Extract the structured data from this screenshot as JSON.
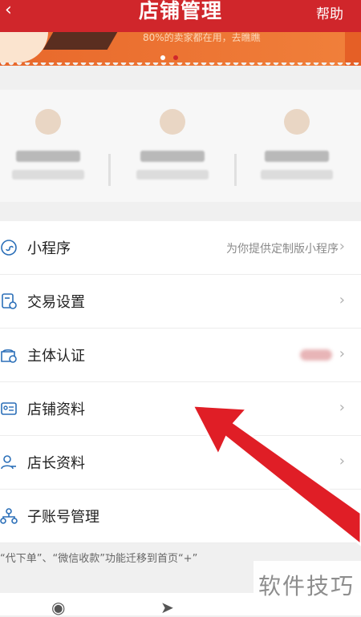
{
  "header": {
    "back_icon": "‹",
    "title": "店铺管理",
    "help": "帮助"
  },
  "banner": {
    "text": "80%的卖家都在用，去瞧瞧",
    "dots": 2
  },
  "menu": [
    {
      "icon": "mini-program-icon",
      "label": "小程序",
      "hint": "为你提供定制版小程序"
    },
    {
      "icon": "trade-settings-icon",
      "label": "交易设置",
      "hint": ""
    },
    {
      "icon": "identity-cert-icon",
      "label": "主体认证",
      "hint": ""
    },
    {
      "icon": "store-info-icon",
      "label": "店铺资料",
      "hint": ""
    },
    {
      "icon": "owner-info-icon",
      "label": "店长资料",
      "hint": ""
    },
    {
      "icon": "sub-account-icon",
      "label": "子账号管理",
      "hint": ""
    }
  ],
  "notice": "“代下单”、“微信收款”功能迁移到首页“+”",
  "watermark": "软件技巧",
  "colors": {
    "primary": "#d0262b",
    "banner": "#e8682b",
    "icon": "#2b6fb8",
    "arrow": "#e01e26"
  }
}
